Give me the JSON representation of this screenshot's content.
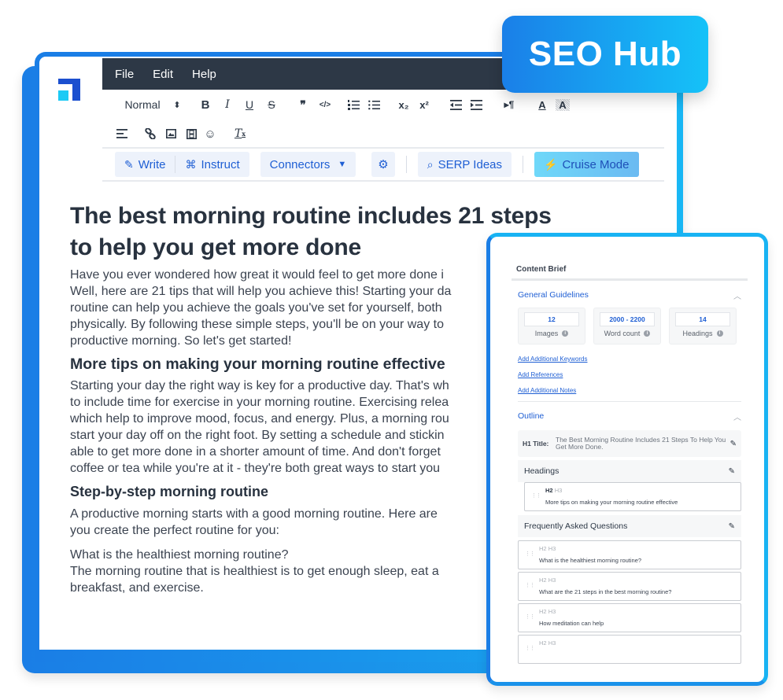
{
  "badge": {
    "label": "SEO Hub"
  },
  "colors": {
    "accent_blue": "#1a7ee6",
    "accent_cyan": "#18b6f4",
    "menubar": "#2d3846",
    "link_blue": "#1f5fd4"
  },
  "menu": [
    "File",
    "Edit",
    "Help"
  ],
  "toolbar": {
    "style_select": "Normal",
    "row1_icons": [
      "bold-icon",
      "italic-icon",
      "underline-icon",
      "strikethrough-icon",
      "blockquote-icon",
      "code-icon",
      "ordered-list-icon",
      "bullet-list-icon",
      "subscript-icon",
      "superscript-icon",
      "outdent-icon",
      "indent-icon",
      "text-direction-icon",
      "font-color-icon",
      "background-color-icon"
    ],
    "row2_icons": [
      "align-icon",
      "link-icon",
      "image-icon",
      "video-icon",
      "emoji-icon",
      "clear-format-icon"
    ],
    "glyphs": {
      "bold": "B",
      "italic": "I",
      "underline": "U",
      "strike": "S",
      "quote": "❞",
      "code": "</>",
      "sub": "x₂",
      "sup": "x²",
      "para": "▸¶",
      "fontcolor": "A",
      "bgcolor": "A",
      "clear": "T"
    }
  },
  "ai_bar": {
    "write": "Write",
    "instruct": "Instruct",
    "connectors": "Connectors",
    "serp": "SERP Ideas",
    "cruise": "Cruise Mode"
  },
  "document": {
    "title": "The best morning routine includes 21 steps to help you get more done",
    "intro": [
      "Have you ever wondered how great it would feel to get more done i",
      "Well, here are 21 tips that will help you achieve this! Starting your da",
      "routine can help you achieve the goals you've set for yourself, both",
      "physically. By following these simple steps, you'll be on your way to",
      "productive morning. So let's get started!"
    ],
    "h2": "More tips on making your morning routine effective",
    "tips": [
      "Starting your day the right way is key for a productive day. That's wh",
      "to include time for exercise in your morning routine. Exercising relea",
      "which help to improve mood, focus, and energy. Plus, a morning rou",
      "start your day off on the right foot. By setting a schedule and stickin",
      "able to get more done in a shorter amount of time. And don't forget",
      "coffee or tea while you're at it - they're both great ways to start you"
    ],
    "h3": "Step-by-step morning routine",
    "steps": [
      "A productive morning starts with a good morning routine. Here are",
      "you create the perfect routine for you:"
    ],
    "faq": [
      "What is the healthiest morning routine?",
      "The morning routine that is healthiest is to get enough sleep, eat a",
      "breakfast, and exercise."
    ]
  },
  "brief": {
    "title": "Content Brief",
    "general": {
      "title": "General Guidelines",
      "stats": [
        {
          "value": "12",
          "label": "Images"
        },
        {
          "value": "2000 - 2200",
          "label": "Word count"
        },
        {
          "value": "14",
          "label": "Headings"
        }
      ],
      "links": [
        "Add Additional Keywords",
        "Add References",
        "Add Additional Notes"
      ]
    },
    "outline": {
      "title": "Outline",
      "h1_label": "H1 Title:",
      "h1_text": "The Best Morning Routine Includes 21 Steps To Help You Get More Done.",
      "headings_title": "Headings",
      "headings": [
        {
          "active": "H2",
          "text": "More tips on making your morning routine effective"
        }
      ],
      "faq_title": "Frequently Asked Questions",
      "faqs": [
        {
          "text": "What is the healthiest morning routine?"
        },
        {
          "text": "What are the 21 steps in the best morning routine?"
        },
        {
          "text": "How meditation can help"
        },
        {
          "text": ""
        }
      ],
      "tag_h2": "H2",
      "tag_h3": "H3"
    }
  }
}
